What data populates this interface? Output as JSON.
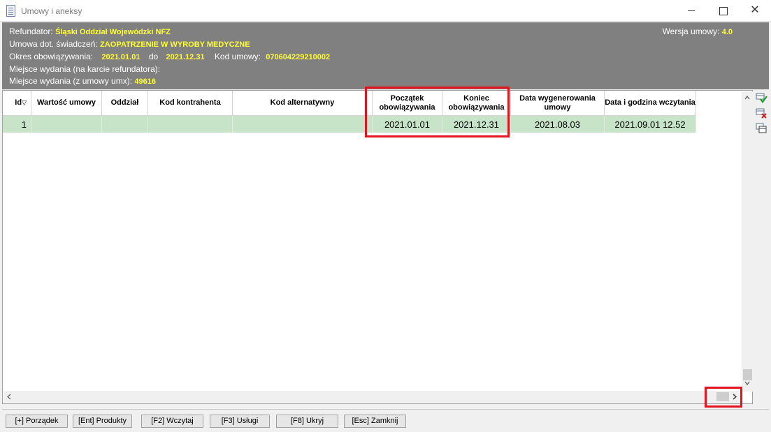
{
  "window": {
    "title": "Umowy i aneksy"
  },
  "header": {
    "refundator_label": "Refundator:",
    "refundator_value": "Śląski Oddział Wojewódzki NFZ",
    "umowa_label": "Umowa dot. świadczeń:",
    "umowa_value": "ZAOPATRZENIE W WYROBY MEDYCZNE",
    "okres_label": "Okres obowiązywania:",
    "okres_od": "2021.01.01",
    "okres_do_label": "do",
    "okres_do": "2021.12.31",
    "kod_umowy_label": "Kod umowy:",
    "kod_umowy_value": "070604229210002",
    "miejsce_karta_label": "Miejsce wydania (na karcie refundatora):",
    "miejsce_umx_label": "Miejsce wydania (z umowy umx):",
    "miejsce_umx_value": "49616",
    "wersja_label": "Wersja umowy:",
    "wersja_value": "4.0"
  },
  "table": {
    "columns": [
      {
        "key": "id",
        "label": "Id"
      },
      {
        "key": "wartosc",
        "label": "Wartość umowy"
      },
      {
        "key": "oddzial",
        "label": "Oddział"
      },
      {
        "key": "kod_kontrahenta",
        "label": "Kod kontrahenta"
      },
      {
        "key": "kod_alternatywny",
        "label": "Kod alternatywny"
      },
      {
        "key": "poczatek",
        "label": "Początek obowiązywania"
      },
      {
        "key": "koniec",
        "label": "Koniec obowiązywania"
      },
      {
        "key": "data_wygen",
        "label": "Data wygenerowania umowy"
      },
      {
        "key": "data_wczyt",
        "label": "Data i godzina wczytania"
      }
    ],
    "rows": [
      {
        "id": "1",
        "wartosc": "",
        "oddzial": "",
        "kod_kontrahenta": "",
        "kod_alternatywny": "",
        "poczatek": "2021.01.01",
        "koniec": "2021.12.31",
        "data_wygen": "2021.08.03",
        "data_wczyt": "2021.09.01 12.52"
      }
    ],
    "sort_indicator": "▽"
  },
  "buttons": {
    "porzadek": "[+] Porządek",
    "produkty": "[Ent] Produkty",
    "wczytaj": "[F2] Wczytaj",
    "uslugi": "[F3] Usługi",
    "ukryj": "[F8] Ukryj",
    "zamknij": "[Esc] Zamknij"
  },
  "colors": {
    "header_bg": "#808080",
    "header_value": "#ffff33",
    "selected_row": "#c8e4c8",
    "highlight": "#e3141e"
  }
}
